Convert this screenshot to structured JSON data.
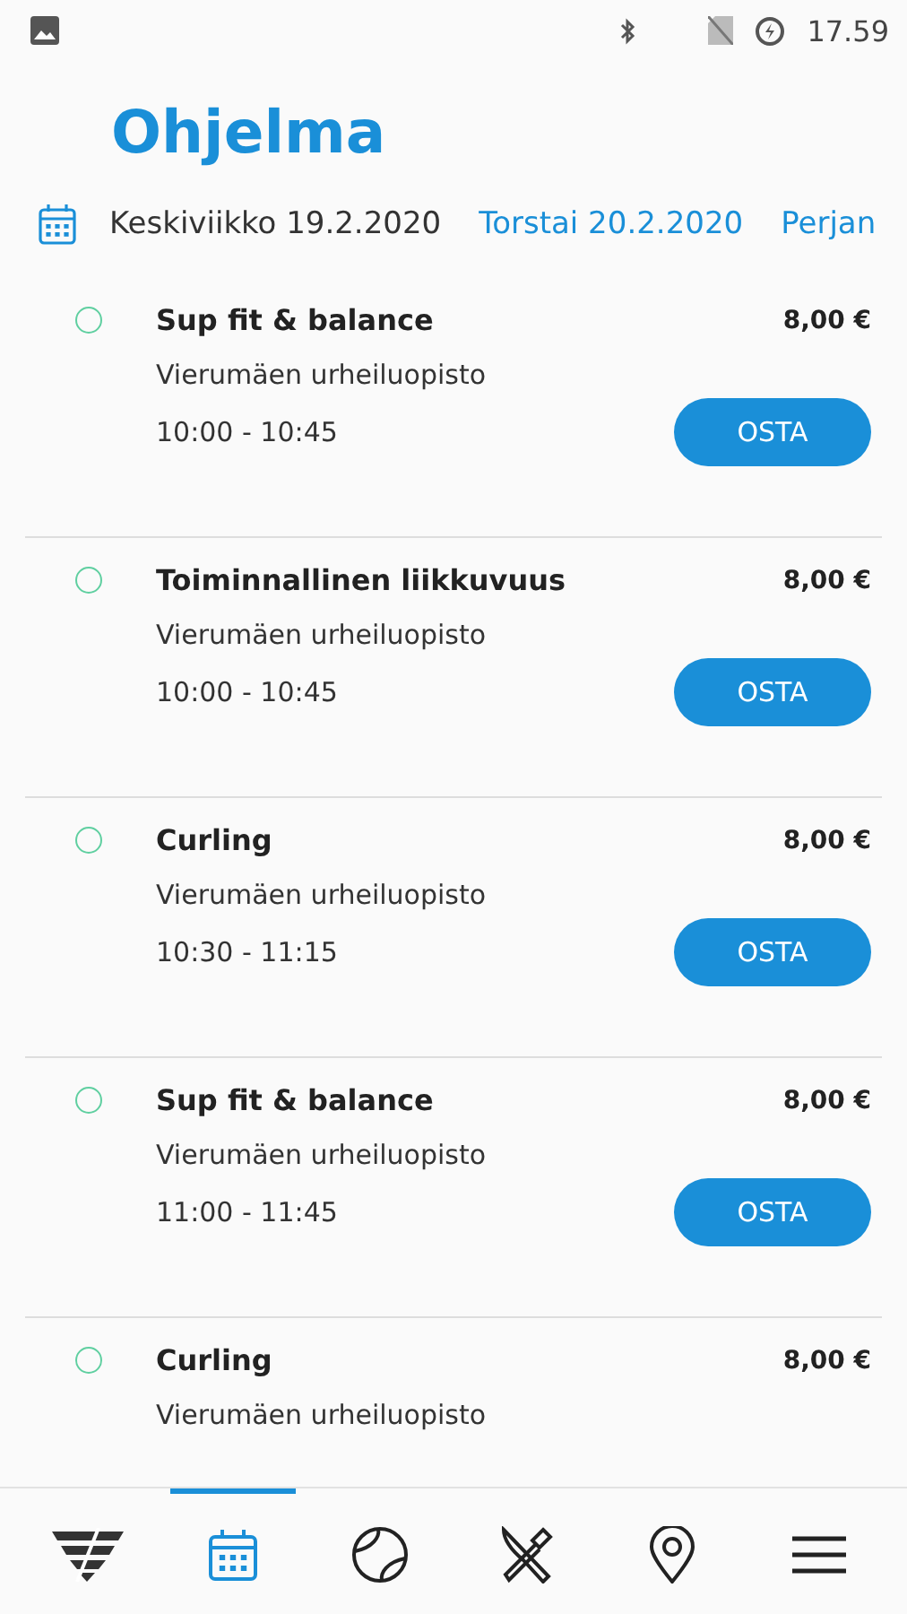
{
  "status_bar": {
    "time": "17.59"
  },
  "title": "Ohjelma",
  "dates": [
    {
      "label": "Keskiviikko 19.2.2020",
      "selected": true
    },
    {
      "label": "Torstai 20.2.2020",
      "selected": false
    },
    {
      "label": "Perjan",
      "selected": false
    }
  ],
  "events": [
    {
      "name": "Sup fit & balance",
      "price": "8,00 €",
      "venue": "Vierumäen urheiluopisto",
      "time": "10:00 - 10:45",
      "button": "OSTA",
      "checked": false
    },
    {
      "name": "Toiminnallinen liikkuvuus",
      "price": "8,00 €",
      "venue": "Vierumäen urheiluopisto",
      "time": "10:00 - 10:45",
      "button": "OSTA",
      "checked": false
    },
    {
      "name": "Curling",
      "price": "8,00 €",
      "venue": "Vierumäen urheiluopisto",
      "time": "10:30 - 11:15",
      "button": "OSTA",
      "checked": false
    },
    {
      "name": "Sup fit & balance",
      "price": "8,00 €",
      "venue": "Vierumäen urheiluopisto",
      "time": "11:00 - 11:45",
      "button": "OSTA",
      "checked": false
    },
    {
      "name": "Curling",
      "price": "8,00 €",
      "venue": "Vierumäen urheiluopisto",
      "checked": false
    }
  ],
  "nav": [
    {
      "kind": "logo",
      "selected": false
    },
    {
      "kind": "calendar",
      "selected": true
    },
    {
      "kind": "ball",
      "selected": false
    },
    {
      "kind": "food",
      "selected": false
    },
    {
      "kind": "location",
      "selected": false
    },
    {
      "kind": "menu",
      "selected": false
    }
  ]
}
